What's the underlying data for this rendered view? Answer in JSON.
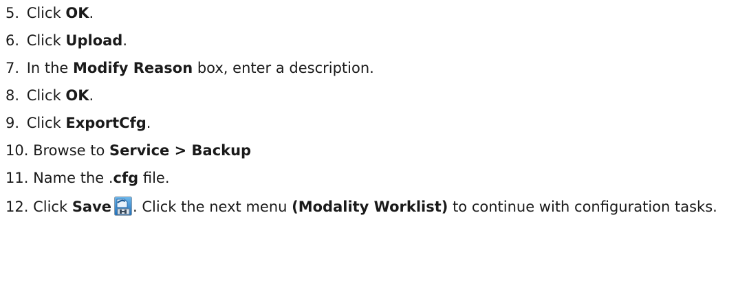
{
  "steps": [
    {
      "num": "5.",
      "pre": "Click ",
      "bold": "OK",
      "post": "."
    },
    {
      "num": "6.",
      "pre": "Click ",
      "bold": "Upload",
      "post": "."
    },
    {
      "num": "7.",
      "pre": "In the ",
      "bold": "Modify Reason",
      "post": " box, enter a description."
    },
    {
      "num": "8.",
      "pre": "Click ",
      "bold": "OK",
      "post": "."
    },
    {
      "num": "9.",
      "pre": "Click ",
      "bold": "ExportCfg",
      "post": "."
    },
    {
      "num": "10.",
      "pre": "Browse to ",
      "bold": "Service > Backup",
      "post": ""
    },
    {
      "num": "11.",
      "pre": "Name the .",
      "bold": "cfg",
      "post": " file."
    }
  ],
  "step12": {
    "num": "12.",
    "pre": "Click ",
    "bold": "Save",
    "icon": "save-icon",
    "mid": ". Click the next menu ",
    "bold2": "(Modality Worklist)",
    "post": " to continue with configuration tasks."
  }
}
